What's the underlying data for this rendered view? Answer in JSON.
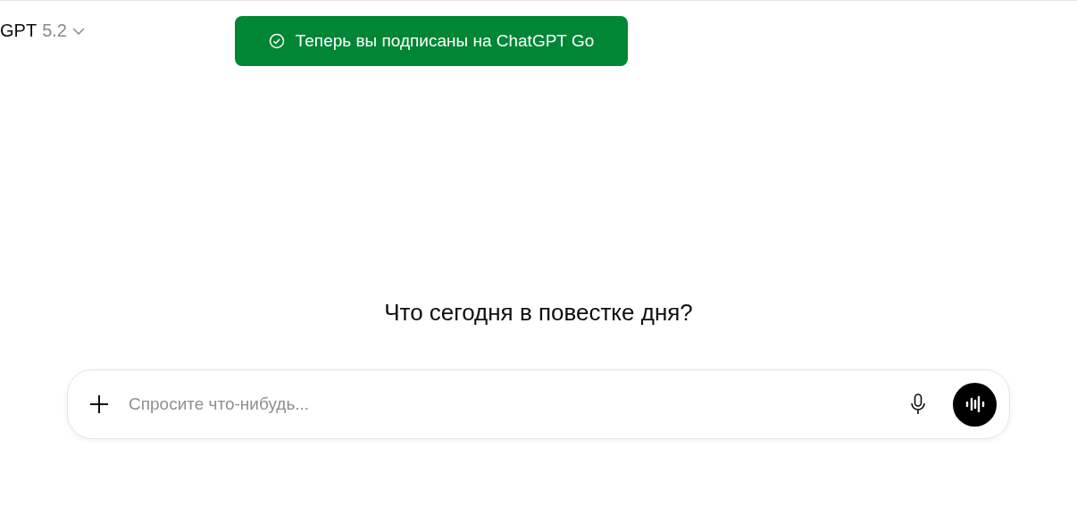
{
  "model_selector": {
    "name": "GPT",
    "version": "5.2"
  },
  "toast": {
    "message": "Теперь вы подписаны на ChatGPT Go"
  },
  "heading": "Что сегодня в повестке дня?",
  "composer": {
    "placeholder": "Спросите что-нибудь..."
  }
}
